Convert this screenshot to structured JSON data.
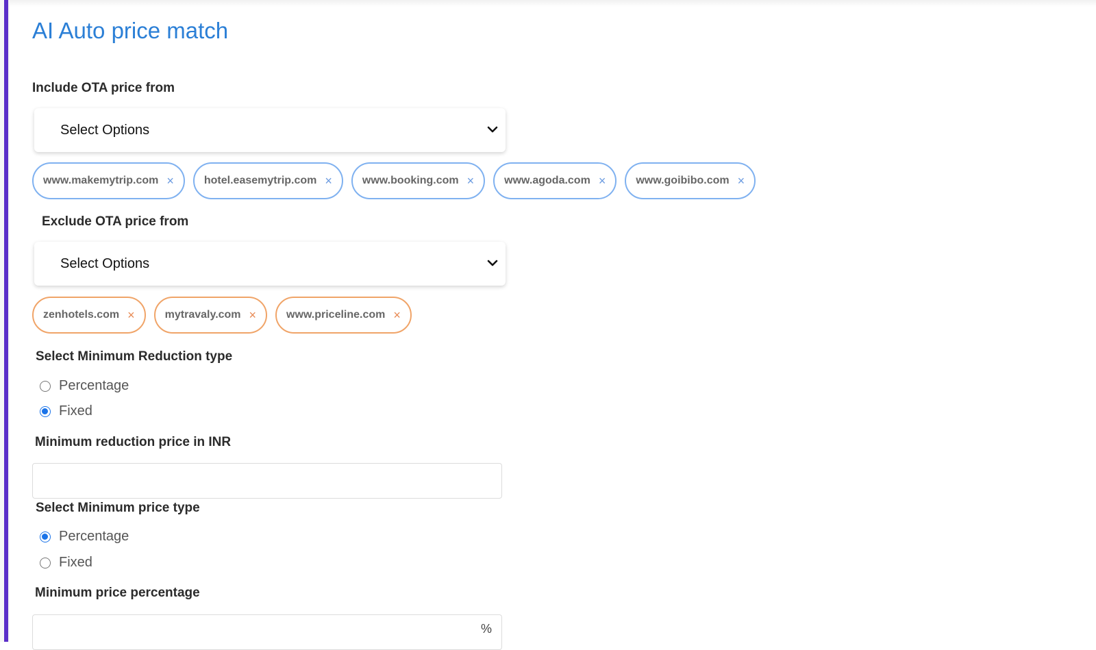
{
  "page": {
    "title": "AI Auto price match"
  },
  "include_ota": {
    "label": "Include OTA price from",
    "placeholder": "Select Options",
    "chips": [
      "www.makemytrip.com",
      "hotel.easemytrip.com",
      "www.booking.com",
      "www.agoda.com",
      "www.goibibo.com"
    ]
  },
  "exclude_ota": {
    "label": "Exclude OTA price from",
    "placeholder": "Select Options",
    "chips": [
      "zenhotels.com",
      "mytravaly.com",
      "www.priceline.com"
    ]
  },
  "min_reduction_type": {
    "label": "Select Minimum Reduction type",
    "options": [
      "Percentage",
      "Fixed"
    ],
    "selected": "Fixed"
  },
  "min_reduction_price": {
    "label": "Minimum reduction price in INR",
    "value": ""
  },
  "min_price_type": {
    "label": "Select Minimum price type",
    "options": [
      "Percentage",
      "Fixed"
    ],
    "selected": "Percentage"
  },
  "min_price_percentage": {
    "label": "Minimum price percentage",
    "value": "",
    "suffix": "%"
  },
  "chip_remove_symbol": "×",
  "colors": {
    "accent": "#5b2fc9",
    "title": "#2b7fd6",
    "include_chip_border": "#7fb1f0",
    "exclude_chip_border": "#f0a468",
    "radio_checked": "#1a73e8"
  },
  "icons": {
    "dropdown": "chevron-down-icon",
    "chip_remove": "close-icon"
  }
}
